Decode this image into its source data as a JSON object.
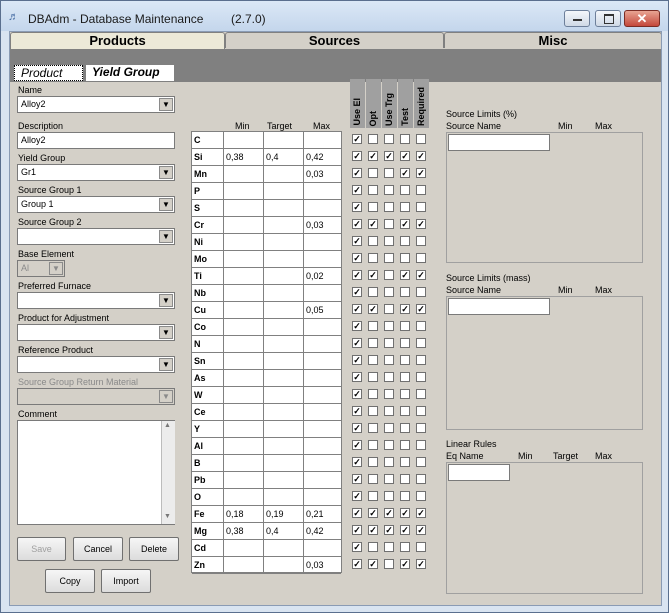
{
  "window": {
    "title": "DBAdm - Database Maintenance",
    "version": "(2.7.0)",
    "icon": "db-tool-icon"
  },
  "tabs": [
    {
      "label": "Products",
      "active": true
    },
    {
      "label": "Sources",
      "active": false
    },
    {
      "label": "Misc",
      "active": false
    }
  ],
  "subtabs": [
    {
      "label": "Product",
      "active": false
    },
    {
      "label": "Yield Group",
      "active": true
    }
  ],
  "form": {
    "name_label": "Name",
    "name_value": "Alloy2",
    "description_label": "Description",
    "description_value": "Alloy2",
    "yield_group_label": "Yield Group",
    "yield_group_value": "Gr1",
    "source_group1_label": "Source Group 1",
    "source_group1_value": "Group 1",
    "source_group2_label": "Source Group 2",
    "source_group2_value": "",
    "base_element_label": "Base Element",
    "base_element_value": "Al",
    "preferred_furnace_label": "Preferred Furnace",
    "preferred_furnace_value": "",
    "product_adjustment_label": "Product for Adjustment",
    "product_adjustment_value": "",
    "reference_product_label": "Reference Product",
    "reference_product_value": "",
    "source_return_label": "Source Group Return Material",
    "source_return_value": "",
    "comment_label": "Comment",
    "comment_value": ""
  },
  "buttons": {
    "save": "Save",
    "cancel": "Cancel",
    "delete": "Delete",
    "copy": "Copy",
    "import": "Import"
  },
  "grid": {
    "col_min": "Min",
    "col_target": "Target",
    "col_max": "Max",
    "check_headers": [
      "Use El",
      "Opt",
      "Use Trg",
      "Test",
      "Required"
    ],
    "rows": [
      {
        "el": "C",
        "min": "",
        "target": "",
        "max": "",
        "checks": [
          true,
          false,
          false,
          false,
          false
        ]
      },
      {
        "el": "Si",
        "min": "0,38",
        "target": "0,4",
        "max": "0,42",
        "checks": [
          true,
          true,
          true,
          true,
          true
        ]
      },
      {
        "el": "Mn",
        "min": "",
        "target": "",
        "max": "0,03",
        "checks": [
          true,
          false,
          false,
          true,
          true
        ]
      },
      {
        "el": "P",
        "min": "",
        "target": "",
        "max": "",
        "checks": [
          true,
          false,
          false,
          false,
          false
        ]
      },
      {
        "el": "S",
        "min": "",
        "target": "",
        "max": "",
        "checks": [
          true,
          false,
          false,
          false,
          false
        ]
      },
      {
        "el": "Cr",
        "min": "",
        "target": "",
        "max": "0,03",
        "checks": [
          true,
          true,
          false,
          true,
          true
        ]
      },
      {
        "el": "Ni",
        "min": "",
        "target": "",
        "max": "",
        "checks": [
          true,
          false,
          false,
          false,
          false
        ]
      },
      {
        "el": "Mo",
        "min": "",
        "target": "",
        "max": "",
        "checks": [
          true,
          false,
          false,
          false,
          false
        ]
      },
      {
        "el": "Ti",
        "min": "",
        "target": "",
        "max": "0,02",
        "checks": [
          true,
          true,
          false,
          true,
          true
        ]
      },
      {
        "el": "Nb",
        "min": "",
        "target": "",
        "max": "",
        "checks": [
          true,
          false,
          false,
          false,
          false
        ]
      },
      {
        "el": "Cu",
        "min": "",
        "target": "",
        "max": "0,05",
        "checks": [
          true,
          true,
          false,
          true,
          true
        ]
      },
      {
        "el": "Co",
        "min": "",
        "target": "",
        "max": "",
        "checks": [
          true,
          false,
          false,
          false,
          false
        ]
      },
      {
        "el": "N",
        "min": "",
        "target": "",
        "max": "",
        "checks": [
          true,
          false,
          false,
          false,
          false
        ]
      },
      {
        "el": "Sn",
        "min": "",
        "target": "",
        "max": "",
        "checks": [
          true,
          false,
          false,
          false,
          false
        ]
      },
      {
        "el": "As",
        "min": "",
        "target": "",
        "max": "",
        "checks": [
          true,
          false,
          false,
          false,
          false
        ]
      },
      {
        "el": "W",
        "min": "",
        "target": "",
        "max": "",
        "checks": [
          true,
          false,
          false,
          false,
          false
        ]
      },
      {
        "el": "Ce",
        "min": "",
        "target": "",
        "max": "",
        "checks": [
          true,
          false,
          false,
          false,
          false
        ]
      },
      {
        "el": "Y",
        "min": "",
        "target": "",
        "max": "",
        "checks": [
          true,
          false,
          false,
          false,
          false
        ]
      },
      {
        "el": "Al",
        "min": "",
        "target": "",
        "max": "",
        "checks": [
          true,
          false,
          false,
          false,
          false
        ]
      },
      {
        "el": "B",
        "min": "",
        "target": "",
        "max": "",
        "checks": [
          true,
          false,
          false,
          false,
          false
        ]
      },
      {
        "el": "Pb",
        "min": "",
        "target": "",
        "max": "",
        "checks": [
          true,
          false,
          false,
          false,
          false
        ]
      },
      {
        "el": "O",
        "min": "",
        "target": "",
        "max": "",
        "checks": [
          true,
          false,
          false,
          false,
          false
        ]
      },
      {
        "el": "Fe",
        "min": "0,18",
        "target": "0,19",
        "max": "0,21",
        "checks": [
          true,
          true,
          true,
          true,
          true
        ]
      },
      {
        "el": "Mg",
        "min": "0,38",
        "target": "0,4",
        "max": "0,42",
        "checks": [
          true,
          true,
          true,
          true,
          true
        ]
      },
      {
        "el": "Cd",
        "min": "",
        "target": "",
        "max": "",
        "checks": [
          true,
          false,
          false,
          false,
          false
        ]
      },
      {
        "el": "Zn",
        "min": "",
        "target": "",
        "max": "0,03",
        "checks": [
          true,
          true,
          false,
          true,
          true
        ]
      }
    ]
  },
  "source_limits_pct": {
    "title": "Source Limits (%)",
    "col_source": "Source Name",
    "col_min": "Min",
    "col_max": "Max"
  },
  "source_limits_mass": {
    "title": "Source Limits (mass)",
    "col_source": "Source Name",
    "col_min": "Min",
    "col_max": "Max"
  },
  "linear_rules": {
    "title": "Linear Rules",
    "col_eq": "Eq Name",
    "col_min": "Min",
    "col_target": "Target",
    "col_max": "Max"
  },
  "colors": {
    "tab_bar": "#808080",
    "window_bg": "#d4d0c8",
    "title_bg": "#dbe8f6"
  }
}
